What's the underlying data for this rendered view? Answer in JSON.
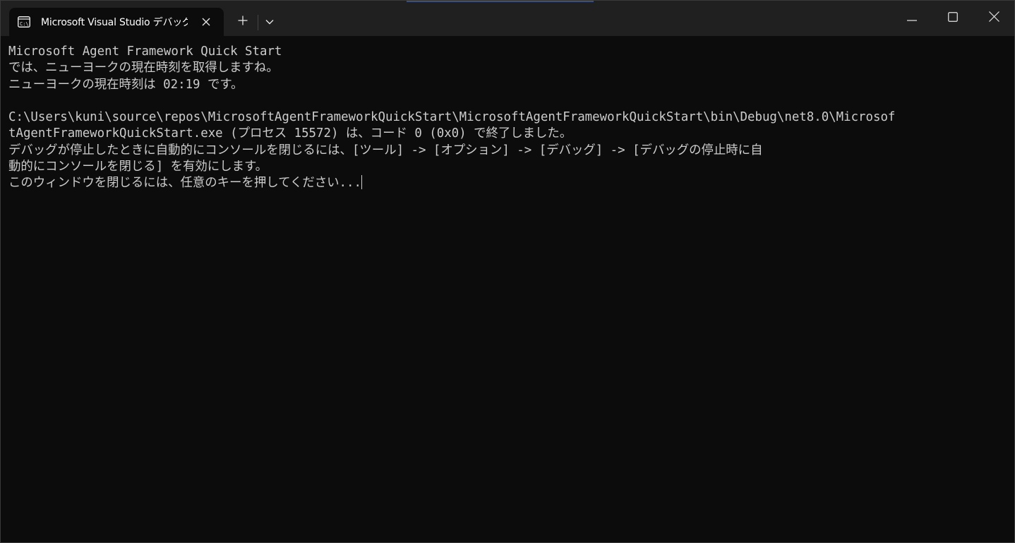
{
  "tab": {
    "title": "Microsoft Visual Studio デバッグ",
    "icon": "console-icon"
  },
  "controls": {
    "new_tab_icon": "plus-icon",
    "dropdown_icon": "chevron-down-icon",
    "minimize_icon": "minimize-icon",
    "maximize_icon": "maximize-icon",
    "close_icon": "close-icon"
  },
  "console": {
    "lines": [
      "Microsoft Agent Framework Quick Start",
      "では、ニューヨークの現在時刻を取得しますね。",
      "ニューヨークの現在時刻は 02:19 です。",
      "",
      "C:\\Users\\kuni\\source\\repos\\MicrosoftAgentFrameworkQuickStart\\MicrosoftAgentFrameworkQuickStart\\bin\\Debug\\net8.0\\Microsof",
      "tAgentFrameworkQuickStart.exe (プロセス 15572) は、コード 0 (0x0) で終了しました。",
      "デバッグが停止したときに自動的にコンソールを閉じるには、[ツール] -> [オプション] -> [デバッグ] -> [デバッグの停止時に自",
      "動的にコンソールを閉じる] を有効にします。",
      "このウィンドウを閉じるには、任意のキーを押してください..."
    ]
  },
  "colors": {
    "background": "#0c0c0c",
    "titlebar": "#202020",
    "text": "#cccccc"
  }
}
